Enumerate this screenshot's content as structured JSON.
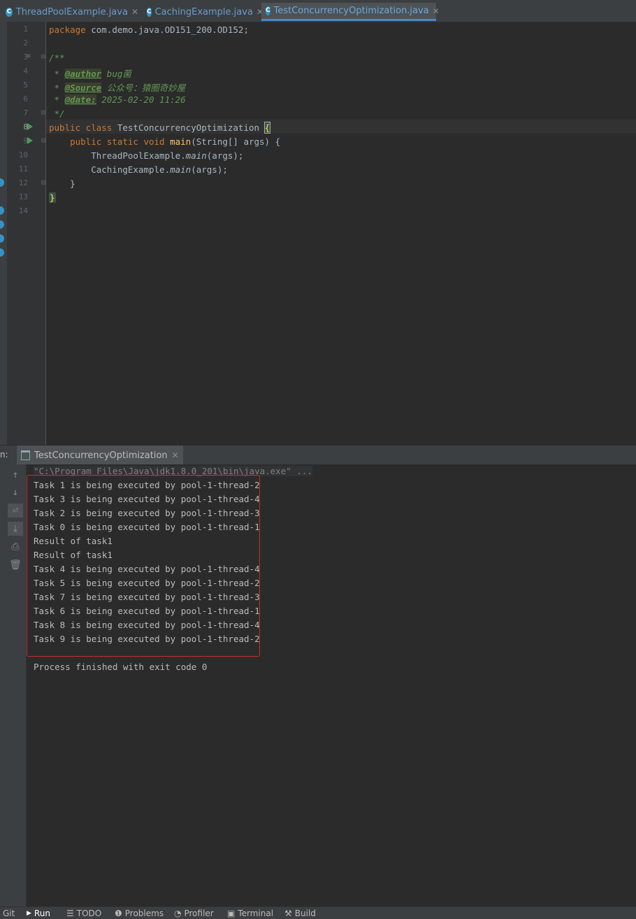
{
  "tabs": [
    {
      "label": "ThreadPoolExample.java",
      "icon": "class-icon",
      "active": false
    },
    {
      "label": "CachingExample.java",
      "icon": "class-icon",
      "active": false
    },
    {
      "label": "TestConcurrencyOptimization.java",
      "icon": "class-icon",
      "active": true
    }
  ],
  "editor": {
    "line_numbers": [
      "1",
      "2",
      "3",
      "4",
      "5",
      "6",
      "7",
      "8",
      "9",
      "10",
      "11",
      "12",
      "13",
      "14"
    ],
    "package_kw": "package",
    "package_name": "com.demo.java.OD151_200.OD152;",
    "doc_open": "/**",
    "author_prefix": " * ",
    "author_tag": "@author",
    "author_val": " bug菌",
    "source_prefix": " * ",
    "source_tag": "@Source",
    "source_val": " 公众号：猿圈奇妙屋",
    "date_prefix": " * ",
    "date_tag": "@date:",
    "date_val": " 2025-02-20 11:26",
    "doc_close": " */",
    "class_kw": "public class ",
    "class_name": "TestConcurrencyOptimization ",
    "class_brace": "{",
    "main_kw": "    public static void ",
    "main_name": "main",
    "main_args": "(String[] args) {",
    "call1_obj": "        ThreadPoolExample.",
    "call1_fn": "main",
    "call1_args": "(args);",
    "call2_obj": "        CachingExample.",
    "call2_fn": "main",
    "call2_args": "(args);",
    "close_method": "    }",
    "close_class": "}"
  },
  "run_panel": {
    "prefix": "n:",
    "tab_label": "TestConcurrencyOptimization",
    "command": "\"C:\\Program Files\\Java\\jdk1.8.0_201\\bin\\java.exe\" ...",
    "output": [
      "Task 1 is being executed by pool-1-thread-2",
      "Task 3 is being executed by pool-1-thread-4",
      "Task 2 is being executed by pool-1-thread-3",
      "Task 0 is being executed by pool-1-thread-1",
      "Result of task1",
      "Result of task1",
      "Task 4 is being executed by pool-1-thread-4",
      "Task 5 is being executed by pool-1-thread-2",
      "Task 7 is being executed by pool-1-thread-3",
      "Task 6 is being executed by pool-1-thread-1",
      "Task 8 is being executed by pool-1-thread-4",
      "Task 9 is being executed by pool-1-thread-2"
    ],
    "finished": "Process finished with exit code 0"
  },
  "bottom_bar": {
    "git": "Git",
    "run": "Run",
    "todo": "TODO",
    "problems": "Problems",
    "profiler": "Profiler",
    "terminal": "Terminal",
    "build": "Build"
  },
  "colors": {
    "accent": "#4a88c7",
    "highlight_box": "#c0302a",
    "run_arrow": "#499c54"
  }
}
